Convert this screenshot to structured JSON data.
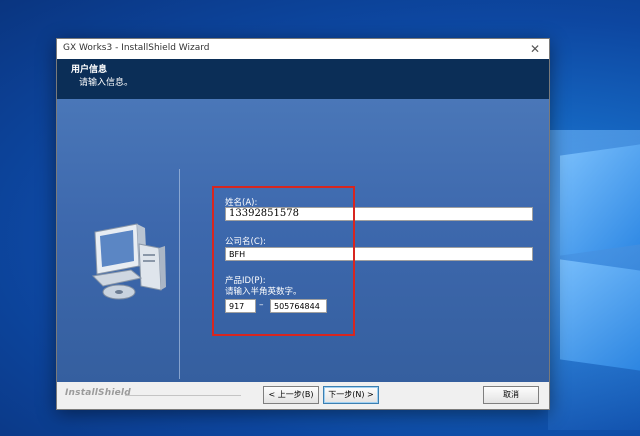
{
  "window": {
    "title": "GX Works3 - InstallShield Wizard",
    "close_glyph": "✕"
  },
  "header": {
    "title": "用户信息",
    "subtitle": "请输入信息。"
  },
  "form": {
    "name_label": "姓名(A):",
    "name_value": "13392851578",
    "company_label": "公司名(C):",
    "company_value": "BFH",
    "product_id_label": "产品ID(P):",
    "product_id_hint": "请输入半角英数字。",
    "product_id_part1": "917",
    "product_id_separator": "–",
    "product_id_part2": "505764844"
  },
  "footer": {
    "brand": "InstallShield",
    "back_label": "< 上一步(B)",
    "next_label": "下一步(N) >",
    "cancel_label": "取消"
  },
  "icons": {
    "window_close": "close-icon",
    "illustration": "computer-cd-icon"
  },
  "colors": {
    "header_bg": "#0b2e57",
    "content_bg": "#4a77b8",
    "highlight_box": "#d8261f",
    "desktop_bg": "#1565c0"
  }
}
